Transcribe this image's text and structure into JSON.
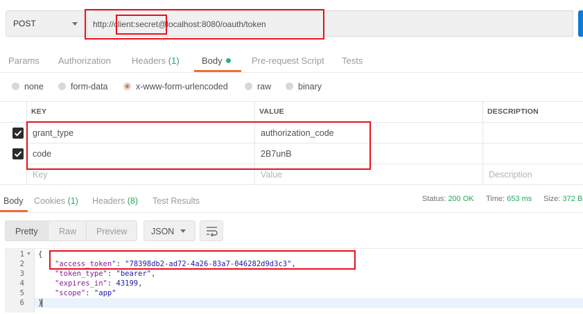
{
  "request": {
    "method": "POST",
    "url_prefix": "http://",
    "url_credentials": "client:secret",
    "url_suffix": "@localhost:8080/oauth/token"
  },
  "request_tabs": [
    {
      "label": "Params"
    },
    {
      "label": "Authorization"
    },
    {
      "label": "Headers",
      "count": "(1)"
    },
    {
      "label": "Body"
    },
    {
      "label": "Pre-request Script"
    },
    {
      "label": "Tests"
    }
  ],
  "body_types": [
    "none",
    "form-data",
    "x-www-form-urlencoded",
    "raw",
    "binary"
  ],
  "body_type_selected": "x-www-form-urlencoded",
  "table": {
    "headers": [
      "KEY",
      "VALUE",
      "DESCRIPTION"
    ],
    "rows": [
      {
        "key": "grant_type",
        "value": "authorization_code",
        "checked": true
      },
      {
        "key": "code",
        "value": "2B7unB",
        "checked": true
      }
    ],
    "placeholder": {
      "key": "Key",
      "value": "Value",
      "description": "Description"
    }
  },
  "response_tabs": [
    {
      "label": "Body"
    },
    {
      "label": "Cookies",
      "count": "(1)"
    },
    {
      "label": "Headers",
      "count": "(8)"
    },
    {
      "label": "Test Results"
    }
  ],
  "status": {
    "status_label": "Status:",
    "status_value": "200 OK",
    "time_label": "Time:",
    "time_value": "653 ms",
    "size_label": "Size:",
    "size_value": "372 B"
  },
  "view_modes": [
    "Pretty",
    "Raw",
    "Preview"
  ],
  "format": "JSON",
  "response_lines": [
    "1",
    "2",
    "3",
    "4",
    "5",
    "6"
  ],
  "response_json": {
    "open": "{",
    "access_token_key": "\"access_token\"",
    "access_token_value": "\"78398db2-ad72-4a26-83a7-046282d9d3c3\"",
    "token_type_key": "\"token_type\"",
    "token_type_value": "\"bearer\"",
    "expires_in_key": "\"expires_in\"",
    "expires_in_value": "43199",
    "scope_key": "\"scope\"",
    "scope_value": "\"app\"",
    "close": "}"
  },
  "colors": {
    "accent": "#f26b3a",
    "success": "#26a55d",
    "highlight": "#e8101a",
    "send": "#0f7ad8"
  }
}
